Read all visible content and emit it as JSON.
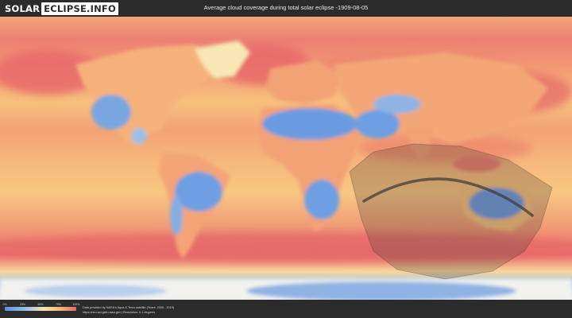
{
  "header": {
    "logo_part1": "SOLAR",
    "logo_part2": "ECLIPSE.INFO",
    "title": "Average cloud coverage during total solar eclipse -1909-08-05"
  },
  "legend": {
    "ticks": [
      "0%",
      "25%",
      "50%",
      "75%",
      "100%"
    ],
    "gradient_colors": [
      "#5b8fd9",
      "#9cc2e8",
      "#f7e7a8",
      "#f6b36f",
      "#e46a6a"
    ]
  },
  "credits": {
    "line1": "Data provided by NASA's Aqua & Terra satellite (Years: 2000 - 2019)",
    "line2": "https://neo.sci.gsfc.nasa.gov | Resolution: 0.1 degrees"
  },
  "map": {
    "colors": {
      "ocean_cloudy": "#ee8a70",
      "ocean_mid": "#f4ad74",
      "clear": "#6d9fe2",
      "light_clear": "#a9c7e6",
      "polar": "#f6f4ee",
      "eclipse_shadow": "#4a3a30",
      "eclipse_path": "#3d3d3d"
    }
  }
}
